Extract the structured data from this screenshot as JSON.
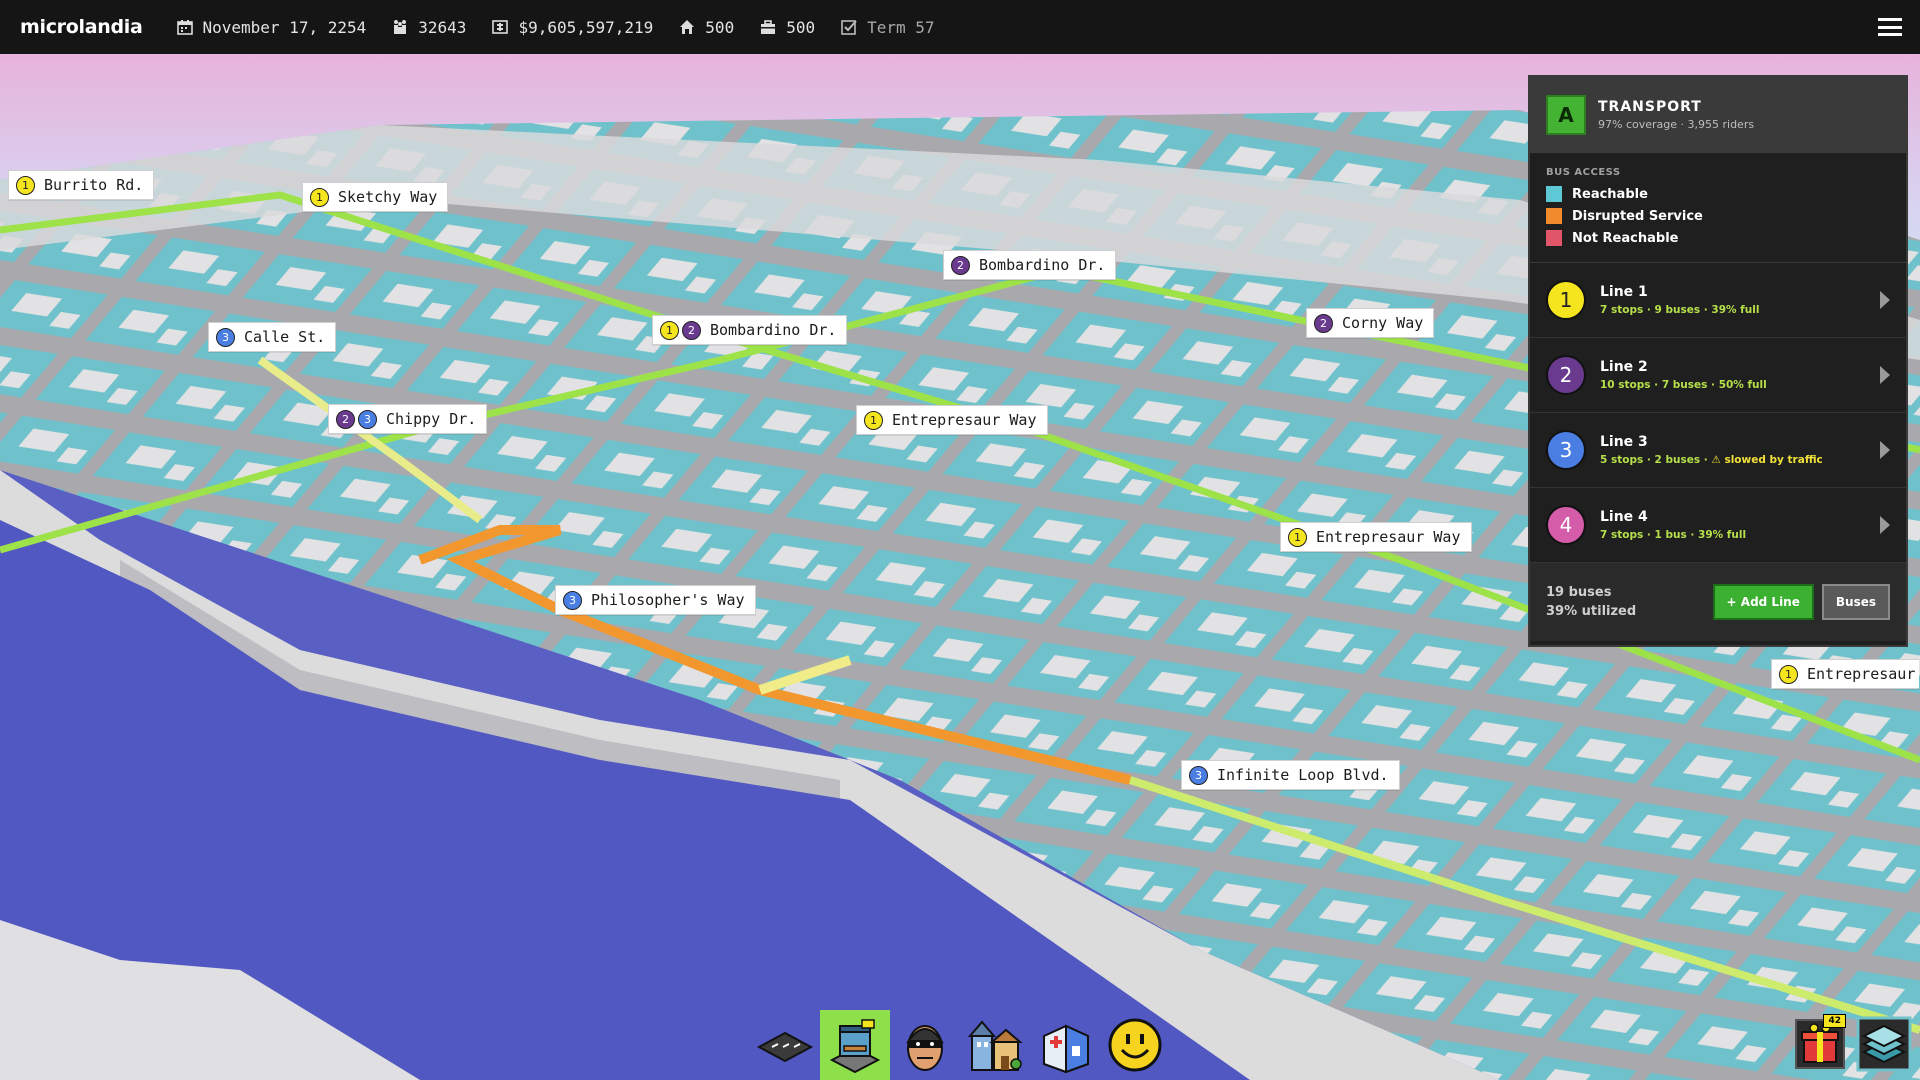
{
  "topbar": {
    "logo": "microlandia",
    "date": "November 17, 2254",
    "population": "32643",
    "funds": "$9,605,597,219",
    "housing": "500",
    "jobs": "500",
    "term": "Term 57",
    "icons": [
      "calendar-icon",
      "people-icon",
      "money-icon",
      "house-icon",
      "briefcase-icon",
      "checkbox-icon",
      "menu-icon"
    ]
  },
  "streets": [
    {
      "lines": [
        "1"
      ],
      "name": "Burrito Rd."
    },
    {
      "lines": [
        "1"
      ],
      "name": "Sketchy Way"
    },
    {
      "lines": [
        "2"
      ],
      "name": "Bombardino Dr."
    },
    {
      "lines": [
        "3"
      ],
      "name": "Calle St."
    },
    {
      "lines": [
        "1",
        "2"
      ],
      "name": "Bombardino Dr."
    },
    {
      "lines": [
        "2"
      ],
      "name": "Corny Way"
    },
    {
      "lines": [
        "2",
        "3"
      ],
      "name": "Chippy Dr."
    },
    {
      "lines": [
        "1"
      ],
      "name": "Entrepresaur Way"
    },
    {
      "lines": [
        "1"
      ],
      "name": "Entrepresaur Way"
    },
    {
      "lines": [
        "3"
      ],
      "name": "Philosopher's Way"
    },
    {
      "lines": [
        "1"
      ],
      "name": "Entrepresaur"
    },
    {
      "lines": [
        "3"
      ],
      "name": "Infinite Loop Blvd."
    }
  ],
  "panel": {
    "grade": "A",
    "title": "TRANSPORT",
    "subtitle": "97% coverage · 3,955 riders",
    "access_title": "BUS ACCESS",
    "legend": [
      {
        "label": "Reachable",
        "color": "#5ec8d6"
      },
      {
        "label": "Disrupted Service",
        "color": "#f08a2a"
      },
      {
        "label": "Not Reachable",
        "color": "#e2566a"
      }
    ],
    "lines": [
      {
        "num": "1",
        "name": "Line 1",
        "detail": "7 stops · 9 buses · 39% full",
        "warn": "",
        "color": "#f5e51e",
        "text": "#222"
      },
      {
        "num": "2",
        "name": "Line 2",
        "detail": "10 stops · 7 buses · 50% full",
        "warn": "",
        "color": "#6a3a8e",
        "text": "#fff"
      },
      {
        "num": "3",
        "name": "Line 3",
        "detail": "5 stops · 2 buses · ",
        "warn": "⚠ slowed by traffic",
        "color": "#4a7ee2",
        "text": "#fff"
      },
      {
        "num": "4",
        "name": "Line 4",
        "detail": "7 stops · 1 bus · 39% full",
        "warn": "",
        "color": "#d45ca8",
        "text": "#fff"
      }
    ],
    "footer_buses": "19 buses",
    "footer_util": "39% utilized",
    "add_line_label": "+ Add Line",
    "buses_label": "Buses"
  },
  "toolbar": {
    "tools": [
      "road-tool-icon",
      "bus-stop-tool-icon",
      "police-tool-icon",
      "housing-tool-icon",
      "hospital-tool-icon",
      "happiness-tool-icon"
    ],
    "active": "bus-stop-tool-icon"
  },
  "corner": {
    "gift_count": "42",
    "icons": [
      "gift-icon",
      "layers-icon"
    ]
  }
}
